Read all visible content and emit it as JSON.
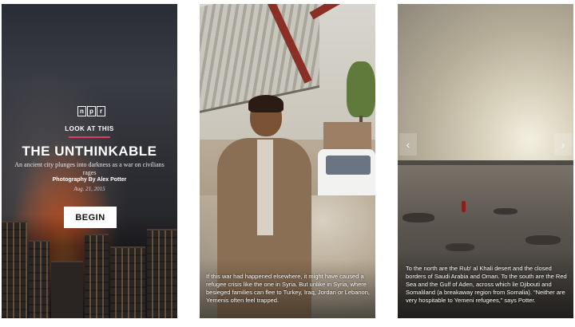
{
  "panel1": {
    "npr_logo_letters": [
      "n",
      "p",
      "r"
    ],
    "kicker": "LOOK AT THIS",
    "headline": "THE UNTHINKABLE",
    "subhead": "An ancient city plunges into darkness as a war on civilians rages",
    "byline": "Photography By Alex Potter",
    "date": "Aug. 21, 2015",
    "begin_label": "BEGIN",
    "accent_color": "#e23b5e"
  },
  "panel2": {
    "caption": "If this war had happened elsewhere, it might have caused a refugee crisis like the one in Syria. But unlike in Syria, where besieged families can flee to Turkey, Iraq, Jordan or Lebanon, Yemenis often feel trapped."
  },
  "panel3": {
    "prev_icon": "chevron-left-icon",
    "next_icon": "chevron-right-icon",
    "caption": "To the north are the Rub' al Khali desert and the closed borders of Saudi Arabia and Oman. To the south are the Red Sea and the Gulf of Aden, across which lie Djibouti and Somaliland (a breakaway region from Somalia). “Neither are very hospitable to Yemeni refugees,” says Potter."
  }
}
